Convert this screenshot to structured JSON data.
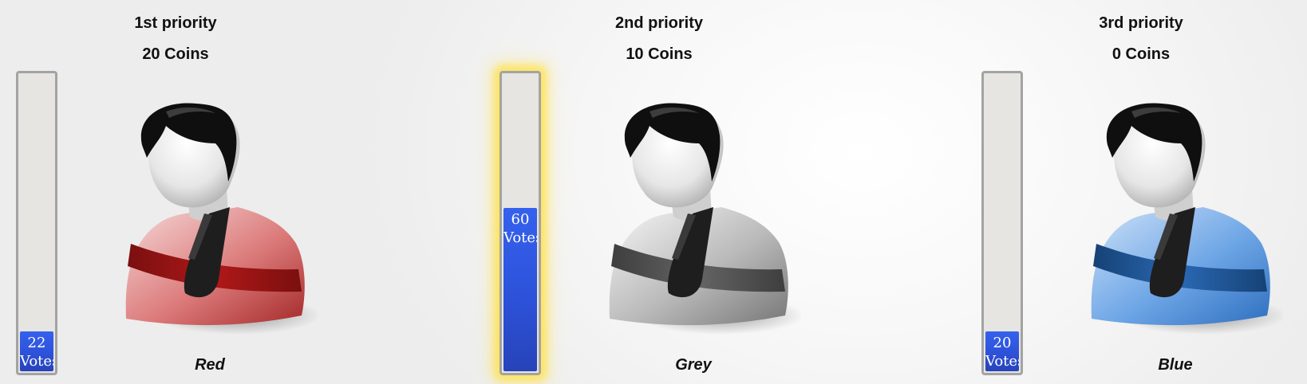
{
  "candidates": [
    {
      "priority": "1st priority",
      "coins": "20 Coins",
      "votes_number": "22",
      "votes_unit": "Votes",
      "vote_share": 0.09,
      "name": "Red",
      "highlighted": false,
      "colors": {
        "light": "#f6dada",
        "mid": "#dc7b7b",
        "dark": "#a52a2a",
        "band": "#b01818",
        "band_dark": "#7a0f0f"
      }
    },
    {
      "priority": "2nd priority",
      "coins": "10 Coins",
      "votes_number": "60",
      "votes_unit": "Votes",
      "vote_share": 0.55,
      "name": "Grey",
      "highlighted": true,
      "colors": {
        "light": "#f7f7f7",
        "mid": "#b9b9b9",
        "dark": "#777777",
        "band": "#646464",
        "band_dark": "#3e3e3e"
      }
    },
    {
      "priority": "3rd priority",
      "coins": "0 Coins",
      "votes_number": "20",
      "votes_unit": "Votes",
      "vote_share": 0.07,
      "name": "Blue",
      "highlighted": false,
      "colors": {
        "light": "#cfe2f8",
        "mid": "#6ea6e6",
        "dark": "#2e6fbf",
        "band": "#2a68b4",
        "band_dark": "#164275"
      }
    }
  ],
  "icons": {
    "avatar": "user-silhouette-icon"
  }
}
